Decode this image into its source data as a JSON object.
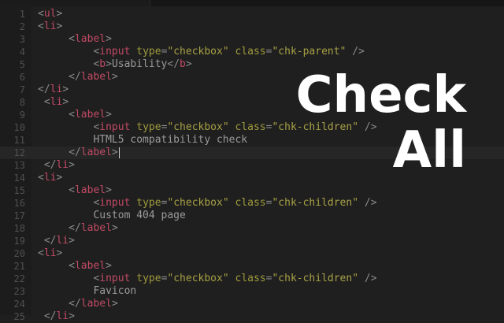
{
  "overlay": {
    "line1": "Check",
    "line2": "All"
  },
  "editor": {
    "active_line": 12,
    "lines": [
      {
        "n": "1",
        "tokens": [
          [
            "b",
            "<"
          ],
          [
            "t",
            "ul"
          ],
          [
            "b",
            ">"
          ]
        ]
      },
      {
        "n": "2",
        "tokens": [
          [
            "b",
            "<"
          ],
          [
            "t",
            "li"
          ],
          [
            "b",
            ">"
          ]
        ]
      },
      {
        "n": "3",
        "tokens": [
          [
            "x",
            "     "
          ],
          [
            "b",
            "<"
          ],
          [
            "t",
            "label"
          ],
          [
            "b",
            ">"
          ]
        ]
      },
      {
        "n": "4",
        "tokens": [
          [
            "x",
            "         "
          ],
          [
            "b",
            "<"
          ],
          [
            "t",
            "input"
          ],
          [
            "x",
            " "
          ],
          [
            "a",
            "type"
          ],
          [
            "b",
            "="
          ],
          [
            "s",
            "\"checkbox\""
          ],
          [
            "x",
            " "
          ],
          [
            "a",
            "class"
          ],
          [
            "b",
            "="
          ],
          [
            "s",
            "\"chk-parent\""
          ],
          [
            "x",
            " "
          ],
          [
            "b",
            "/>"
          ]
        ]
      },
      {
        "n": "5",
        "tokens": [
          [
            "x",
            "         "
          ],
          [
            "b",
            "<"
          ],
          [
            "t",
            "b"
          ],
          [
            "b",
            ">"
          ],
          [
            "x",
            "Usability"
          ],
          [
            "b",
            "</"
          ],
          [
            "t",
            "b"
          ],
          [
            "b",
            ">"
          ]
        ]
      },
      {
        "n": "6",
        "tokens": [
          [
            "x",
            "     "
          ],
          [
            "b",
            "</"
          ],
          [
            "t",
            "label"
          ],
          [
            "b",
            ">"
          ]
        ]
      },
      {
        "n": "7",
        "tokens": [
          [
            "b",
            "</"
          ],
          [
            "t",
            "li"
          ],
          [
            "b",
            ">"
          ]
        ]
      },
      {
        "n": "8",
        "tokens": [
          [
            "x",
            " "
          ],
          [
            "b",
            "<"
          ],
          [
            "t",
            "li"
          ],
          [
            "b",
            ">"
          ]
        ]
      },
      {
        "n": "9",
        "tokens": [
          [
            "x",
            "     "
          ],
          [
            "b",
            "<"
          ],
          [
            "t",
            "label"
          ],
          [
            "b",
            ">"
          ]
        ]
      },
      {
        "n": "10",
        "tokens": [
          [
            "x",
            "         "
          ],
          [
            "b",
            "<"
          ],
          [
            "t",
            "input"
          ],
          [
            "x",
            " "
          ],
          [
            "a",
            "type"
          ],
          [
            "b",
            "="
          ],
          [
            "s",
            "\"checkbox\""
          ],
          [
            "x",
            " "
          ],
          [
            "a",
            "class"
          ],
          [
            "b",
            "="
          ],
          [
            "s",
            "\"chk-children\""
          ],
          [
            "x",
            " "
          ],
          [
            "b",
            "/>"
          ]
        ]
      },
      {
        "n": "11",
        "tokens": [
          [
            "x",
            "         HTML5 compatibility check"
          ]
        ]
      },
      {
        "n": "12",
        "tokens": [
          [
            "x",
            "     "
          ],
          [
            "b",
            "</"
          ],
          [
            "t",
            "label"
          ],
          [
            "b",
            ">"
          ]
        ]
      },
      {
        "n": "13",
        "tokens": [
          [
            "x",
            " "
          ],
          [
            "b",
            "</"
          ],
          [
            "t",
            "li"
          ],
          [
            "b",
            ">"
          ]
        ]
      },
      {
        "n": "14",
        "tokens": [
          [
            "b",
            "<"
          ],
          [
            "t",
            "li"
          ],
          [
            "b",
            ">"
          ]
        ]
      },
      {
        "n": "15",
        "tokens": [
          [
            "x",
            "     "
          ],
          [
            "b",
            "<"
          ],
          [
            "t",
            "label"
          ],
          [
            "b",
            ">"
          ]
        ]
      },
      {
        "n": "16",
        "tokens": [
          [
            "x",
            "         "
          ],
          [
            "b",
            "<"
          ],
          [
            "t",
            "input"
          ],
          [
            "x",
            " "
          ],
          [
            "a",
            "type"
          ],
          [
            "b",
            "="
          ],
          [
            "s",
            "\"checkbox\""
          ],
          [
            "x",
            " "
          ],
          [
            "a",
            "class"
          ],
          [
            "b",
            "="
          ],
          [
            "s",
            "\"chk-children\""
          ],
          [
            "x",
            " "
          ],
          [
            "b",
            "/>"
          ]
        ]
      },
      {
        "n": "17",
        "tokens": [
          [
            "x",
            "         Custom 404 page"
          ]
        ]
      },
      {
        "n": "18",
        "tokens": [
          [
            "x",
            "     "
          ],
          [
            "b",
            "</"
          ],
          [
            "t",
            "label"
          ],
          [
            "b",
            ">"
          ]
        ]
      },
      {
        "n": "19",
        "tokens": [
          [
            "x",
            " "
          ],
          [
            "b",
            "</"
          ],
          [
            "t",
            "li"
          ],
          [
            "b",
            ">"
          ]
        ]
      },
      {
        "n": "20",
        "tokens": [
          [
            "b",
            "<"
          ],
          [
            "t",
            "li"
          ],
          [
            "b",
            ">"
          ]
        ]
      },
      {
        "n": "21",
        "tokens": [
          [
            "x",
            "     "
          ],
          [
            "b",
            "<"
          ],
          [
            "t",
            "label"
          ],
          [
            "b",
            ">"
          ]
        ]
      },
      {
        "n": "22",
        "tokens": [
          [
            "x",
            "         "
          ],
          [
            "b",
            "<"
          ],
          [
            "t",
            "input"
          ],
          [
            "x",
            " "
          ],
          [
            "a",
            "type"
          ],
          [
            "b",
            "="
          ],
          [
            "s",
            "\"checkbox\""
          ],
          [
            "x",
            " "
          ],
          [
            "a",
            "class"
          ],
          [
            "b",
            "="
          ],
          [
            "s",
            "\"chk-children\""
          ],
          [
            "x",
            " "
          ],
          [
            "b",
            "/>"
          ]
        ]
      },
      {
        "n": "23",
        "tokens": [
          [
            "x",
            "         Favicon"
          ]
        ]
      },
      {
        "n": "24",
        "tokens": [
          [
            "x",
            "     "
          ],
          [
            "b",
            "</"
          ],
          [
            "t",
            "label"
          ],
          [
            "b",
            ">"
          ]
        ]
      },
      {
        "n": "25",
        "tokens": [
          [
            "x",
            " "
          ],
          [
            "b",
            "</"
          ],
          [
            "t",
            "li"
          ],
          [
            "b",
            ">"
          ]
        ]
      }
    ]
  }
}
